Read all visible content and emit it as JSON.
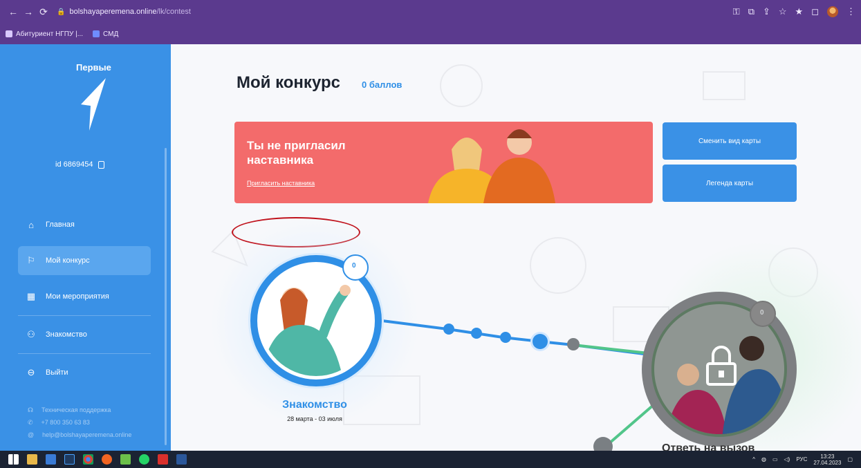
{
  "browser": {
    "url_domain": "bolshayaperemena.online",
    "url_path": "/lk/contest",
    "bookmarks": [
      "Абитуриент НГПУ |...",
      "СМД"
    ]
  },
  "sidebar": {
    "logo_text": "Первые",
    "user_id": "id 6869454",
    "items": [
      {
        "label": "Главная",
        "icon": "home-icon"
      },
      {
        "label": "Мой конкурс",
        "icon": "contest-icon"
      },
      {
        "label": "Мои мероприятия",
        "icon": "calendar-icon"
      },
      {
        "label": "Знакомство",
        "icon": "people-icon"
      },
      {
        "label": "Выйти",
        "icon": "logout-icon"
      }
    ],
    "support": {
      "label": "Техническая поддержка",
      "phone": "+7 800 350 63 83",
      "email": "help@bolshayaperemena.online"
    }
  },
  "main": {
    "title": "Мой конкурс",
    "points": "0 баллов",
    "banner": {
      "title_line1": "Ты не пригласил",
      "title_line2": "наставника",
      "link": "Пригласить наставника"
    },
    "buttons": {
      "change_map": "Сменить вид карты",
      "legend": "Легенда карты"
    },
    "stage1": {
      "title": "Знакомство",
      "dates": "28 марта - 03 июля",
      "score": "0"
    },
    "stage2": {
      "title": "Ответь на вызов",
      "score": "0"
    }
  },
  "taskbar": {
    "lang": "РУС",
    "time": "13:23",
    "date": "27.04.2023"
  },
  "colors": {
    "sidebar": "#3a91e6",
    "banner": "#f36b6b",
    "accent": "#2f8fe6",
    "chrome": "#5b3a8e"
  }
}
